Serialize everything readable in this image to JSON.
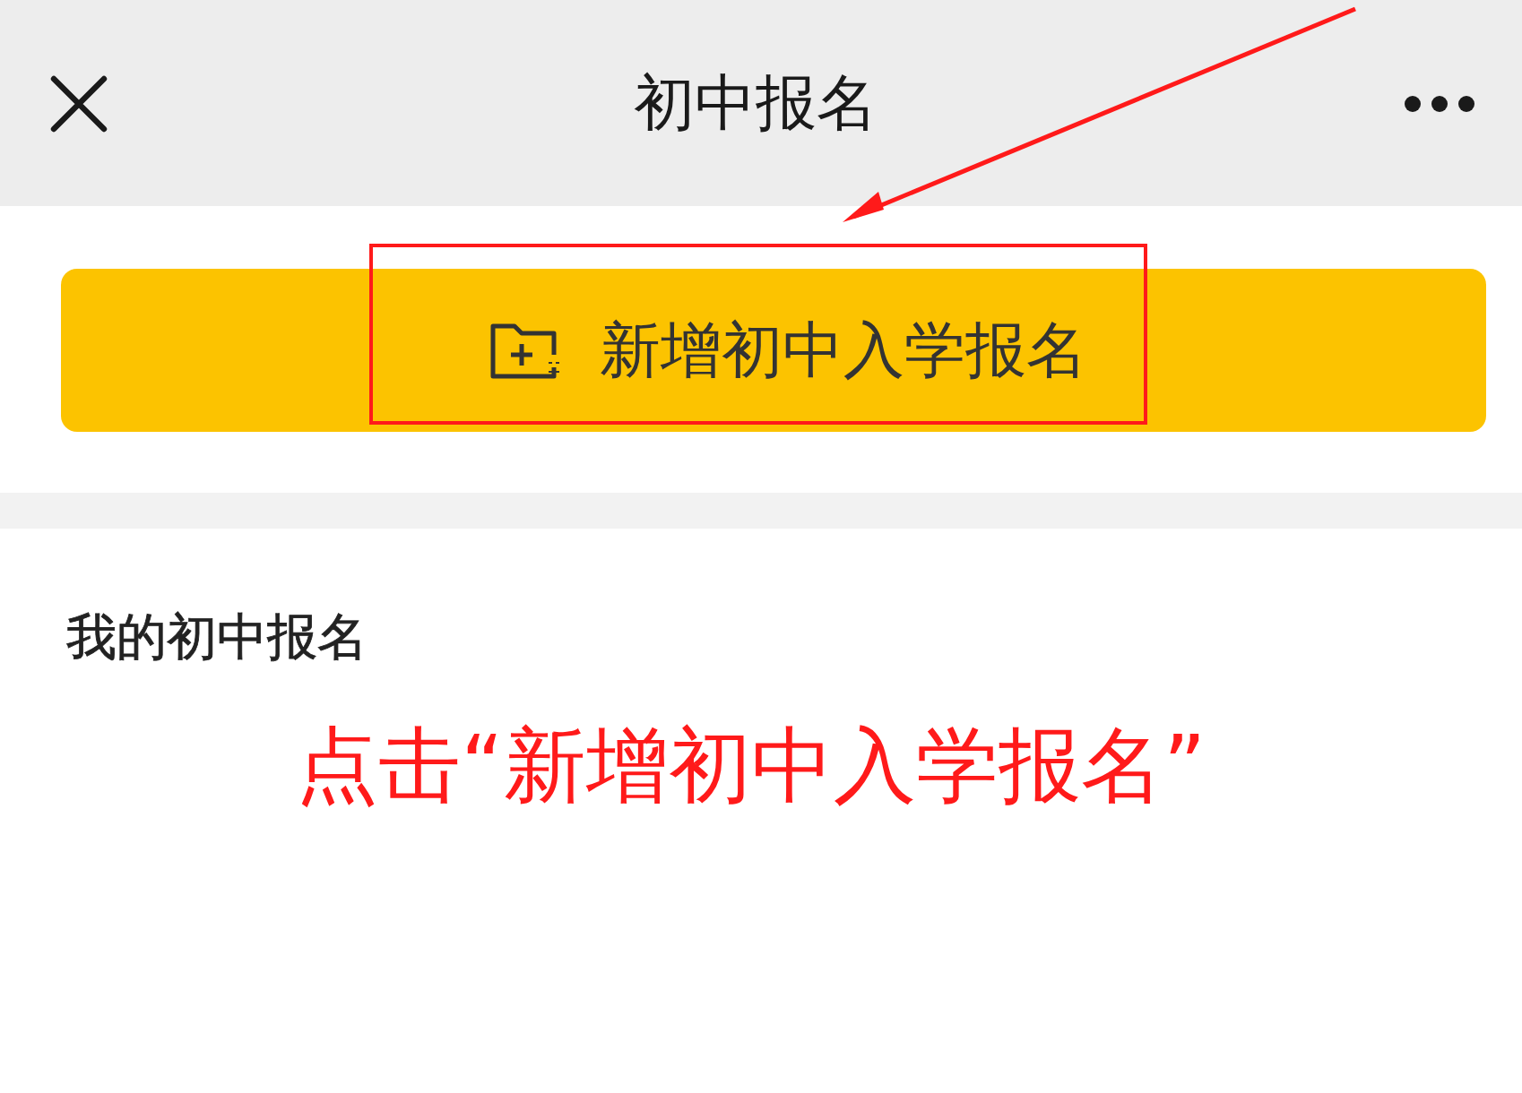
{
  "header": {
    "title": "初中报名"
  },
  "action_button": {
    "label": "新增初中入学报名"
  },
  "section": {
    "title": "我的初中报名"
  },
  "annotation": {
    "text": "点击“新增初中入学报名”"
  }
}
